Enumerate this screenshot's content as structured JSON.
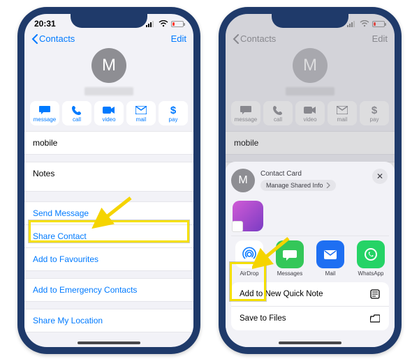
{
  "status": {
    "time": "20:31"
  },
  "nav": {
    "back": "Contacts",
    "edit": "Edit"
  },
  "avatar_initial": "M",
  "actions": {
    "message": "message",
    "call": "call",
    "video": "video",
    "mail": "mail",
    "pay": "pay"
  },
  "fields": {
    "mobile": "mobile",
    "notes": "Notes"
  },
  "links": {
    "send_message": "Send Message",
    "share_contact": "Share Contact",
    "add_favourites": "Add to Favourites",
    "add_emergency": "Add to Emergency Contacts",
    "share_location": "Share My Location"
  },
  "sheet": {
    "title": "Contact Card",
    "manage": "Manage Shared Info",
    "apps": {
      "airdrop": "AirDrop",
      "messages": "Messages",
      "mail": "Mail",
      "whatsapp": "WhatsApp"
    },
    "add_quicknote": "Add to New Quick Note",
    "save_files": "Save to Files"
  }
}
